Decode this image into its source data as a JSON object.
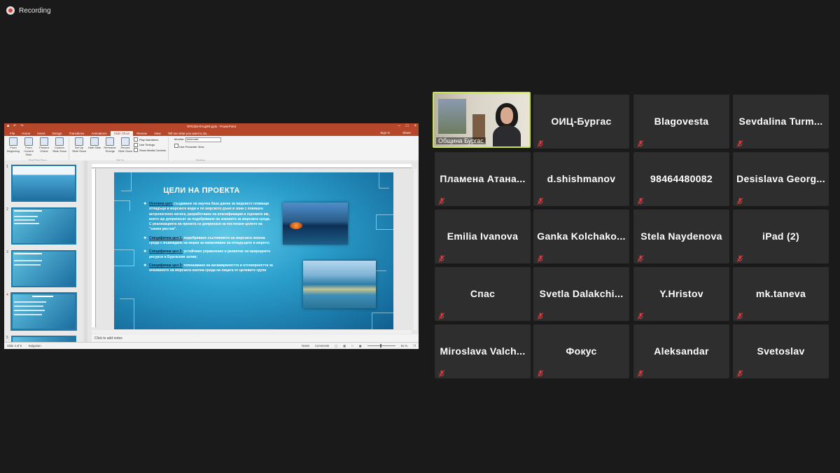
{
  "recording": {
    "label": "Recording"
  },
  "ppt": {
    "title": "ПРЕЗЕНТАЦИЯ.pptx - PowerPoint",
    "tabs": [
      "File",
      "Home",
      "Insert",
      "Design",
      "Transitions",
      "Animations",
      "Slide Show",
      "Review",
      "View"
    ],
    "active_tab": "Slide Show",
    "tell_me": "Tell me what you want to do...",
    "sign_in": "Sign in",
    "share": "Share",
    "ribbon": {
      "start_group_label": "Start Slide Show",
      "setup_group_label": "Set Up",
      "monitors_group_label": "Monitors",
      "buttons": [
        {
          "label": "From Beginning"
        },
        {
          "label": "From Current Slide"
        },
        {
          "label": "Present Online"
        },
        {
          "label": "Custom Slide Show"
        },
        {
          "label": "Set Up Slide Show"
        },
        {
          "label": "Hide Slide"
        },
        {
          "label": "Rehearse Timings"
        },
        {
          "label": "Record Slide Show"
        }
      ],
      "checks": [
        "Play Narrations",
        "Use Timings",
        "Show Media Controls"
      ],
      "monitor_label": "Monitor:",
      "monitor_value": "Automatic",
      "presenter_view": "Use Presenter View"
    },
    "slide": {
      "title": "ЦЕЛИ НА ПРОЕКТА",
      "items": [
        {
          "lead": "Основна цел:",
          "text": " създаване на научна база данни за видовете плаващи отпадъци в морските води и по морското дъно в зони с повишен антропогенен натиск, разработване на класификация и оценката им, които ще допринесат за подобряване на знанията за морската среда. С реализацията на проекта се допринася за постигане целите на \"синия растеж\"."
        },
        {
          "lead": "Специфична цел 1:",
          "text": " подобряване състоянието на морската околна среда с въвеждане на мерки за намаляване на отпадъците в морето;"
        },
        {
          "lead": "Специфична цел 2:",
          "text": " устойчиво управление и развитие на природните ресурси в Бургаския залив;"
        },
        {
          "lead": "Специфична цел 3:",
          "text": " повишаване на ангажираността и отговорността за опазването на морската околна среда на лицата от целевите групи"
        }
      ]
    },
    "thumb_numbers": [
      "1",
      "2",
      "3",
      "4",
      "5"
    ],
    "notes": "Click to add notes",
    "status": {
      "slide": "Slide 4 of 9",
      "language": "Bulgarian",
      "notes_btn": "Notes",
      "comments_btn": "Comments",
      "zoom": "91 %"
    }
  },
  "participants": [
    {
      "name": "Община Бургас",
      "video": true
    },
    {
      "name": "ОИЦ-Бургас"
    },
    {
      "name": "Blagovesta"
    },
    {
      "name": "Sevdalina Turm..."
    },
    {
      "name": "Пламена Атана..."
    },
    {
      "name": "d.shishmanov"
    },
    {
      "name": "98464480082"
    },
    {
      "name": "Desislava Georg..."
    },
    {
      "name": "Emilia Ivanova"
    },
    {
      "name": "Ganka Kolchako..."
    },
    {
      "name": "Stela Naydenova"
    },
    {
      "name": "iPad (2)"
    },
    {
      "name": "Спас"
    },
    {
      "name": "Svetla Dalakchi..."
    },
    {
      "name": "Y.Hristov"
    },
    {
      "name": "mk.taneva"
    },
    {
      "name": "Miroslava Valch..."
    },
    {
      "name": "Фокус"
    },
    {
      "name": "Aleksandar"
    },
    {
      "name": "Svetoslav"
    }
  ],
  "colors": {
    "ppt_accent": "#b7472a",
    "active_speaker": "#c8e64b",
    "muted_icon": "#e0393e",
    "tile_bg": "#2e2e2e"
  }
}
